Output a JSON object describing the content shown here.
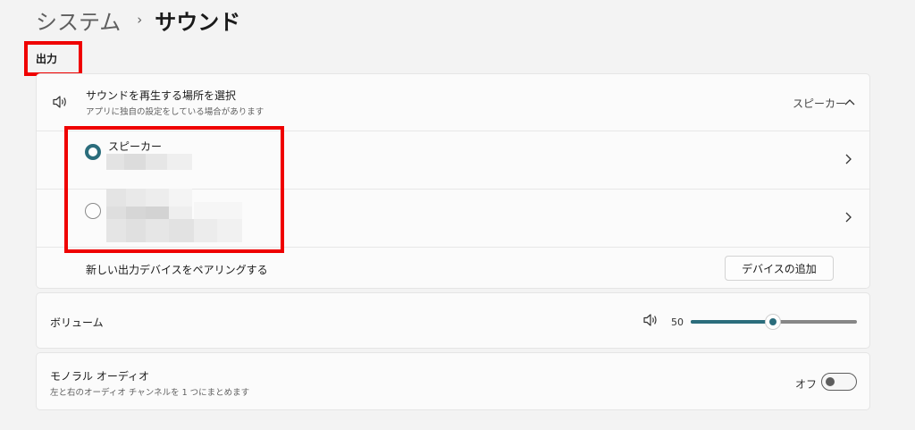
{
  "breadcrumb": {
    "parent": "システム",
    "separator": "›",
    "current": "サウンド"
  },
  "output_section": {
    "title": "出力",
    "location": {
      "title": "サウンドを再生する場所を選択",
      "subtitle": "アプリに独自の設定をしている場合があります",
      "selected_value": "スピーカー",
      "expanded": true
    },
    "devices": [
      {
        "label": "スピーカー",
        "selected": true
      },
      {
        "label": "",
        "selected": false
      }
    ],
    "pair": {
      "label": "新しい出力デバイスをペアリングする",
      "button_label": "デバイスの追加"
    }
  },
  "volume": {
    "label": "ボリューム",
    "value": "50",
    "level": 0.5
  },
  "mono": {
    "title": "モノラル オーディオ",
    "subtitle": "左と右のオーディオ チャンネルを 1 つにまとめます",
    "state_label": "オフ",
    "on": false
  },
  "colors": {
    "accent": "#2b6d7c",
    "highlight": "#ef0000",
    "background": "#f3f3f3",
    "card": "#fbfbfb"
  },
  "icons": [
    "speaker-icon",
    "chevron-up-icon",
    "chevron-right-icon",
    "speaker-small-icon"
  ]
}
